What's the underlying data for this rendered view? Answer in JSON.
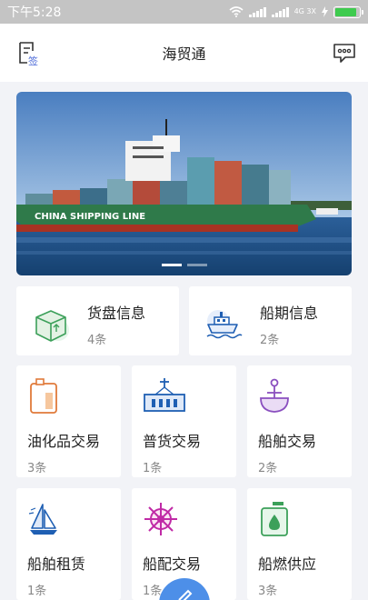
{
  "status_bar": {
    "time": "下午5:28",
    "network": "4G 3X"
  },
  "header": {
    "title": "海贸通",
    "left_icon_label": "签"
  },
  "banner": {
    "ship_hull_text": "CHINA SHIPPING LINE",
    "slide_count": 2,
    "active_slide": 1
  },
  "summary_cards": [
    {
      "title": "货盘信息",
      "count": "4条",
      "icon": "cargo-box-icon"
    },
    {
      "title": "船期信息",
      "count": "2条",
      "icon": "ship-icon"
    }
  ],
  "tiles": [
    {
      "title": "油化品交易",
      "count": "3条",
      "icon": "oil-tank-icon"
    },
    {
      "title": "普货交易",
      "count": "1条",
      "icon": "container-icon"
    },
    {
      "title": "船舶交易",
      "count": "2条",
      "icon": "anchor-icon"
    },
    {
      "title": "船舶租赁",
      "count": "1条",
      "icon": "sailboat-icon"
    },
    {
      "title": "船配交易",
      "count": "1条",
      "icon": "ship-wheel-icon"
    },
    {
      "title": "船燃供应",
      "count": "3条",
      "icon": "fuel-can-icon"
    }
  ],
  "colors": {
    "accent": "#4d8fe8",
    "sea": "#1d4e86",
    "hull": "#2f7a4a"
  }
}
